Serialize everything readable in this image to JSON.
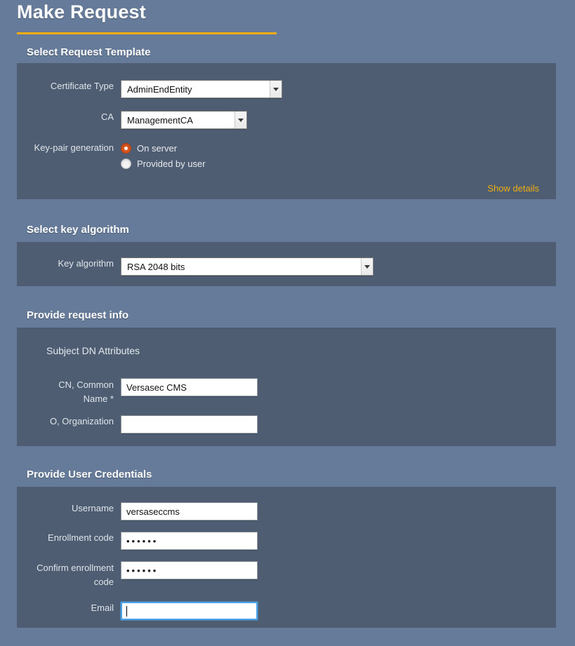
{
  "page": {
    "title": "Make Request",
    "accent_color": "#f0ad10",
    "background_color": "#657b99",
    "panel_color": "#4e5d72",
    "radio_selected_color": "#d9541e",
    "focus_color": "#4aa3e8"
  },
  "sections": {
    "template": {
      "heading": "Select Request Template",
      "certificate_type": {
        "label": "Certificate Type",
        "value": "AdminEndEntity"
      },
      "ca": {
        "label": "CA",
        "value": "ManagementCA"
      },
      "keypair": {
        "label": "Key-pair generation",
        "options": [
          {
            "label": "On server",
            "selected": true
          },
          {
            "label": "Provided by user",
            "selected": false
          }
        ]
      },
      "show_details_link": "Show details"
    },
    "key_algorithm": {
      "heading": "Select key algorithm",
      "field": {
        "label": "Key algorithm",
        "value": "RSA 2048 bits"
      }
    },
    "request_info": {
      "heading": "Provide request info",
      "sub_heading": "Subject DN Attributes",
      "fields": [
        {
          "label": "CN, Common\nName *",
          "value": "Versasec CMS",
          "placeholder": ""
        },
        {
          "label": "O, Organization",
          "value": "",
          "placeholder": ""
        }
      ]
    },
    "credentials": {
      "heading": "Provide User Credentials",
      "fields": [
        {
          "label": "Username",
          "value": "versaseccms",
          "masked": false,
          "focused": false
        },
        {
          "label": "Enrollment code",
          "value": "••••••",
          "masked": true,
          "focused": false
        },
        {
          "label": "Confirm enrollment\ncode",
          "value": "••••••",
          "masked": true,
          "focused": false
        },
        {
          "label": "Email",
          "value": "",
          "masked": false,
          "focused": true
        }
      ]
    }
  }
}
